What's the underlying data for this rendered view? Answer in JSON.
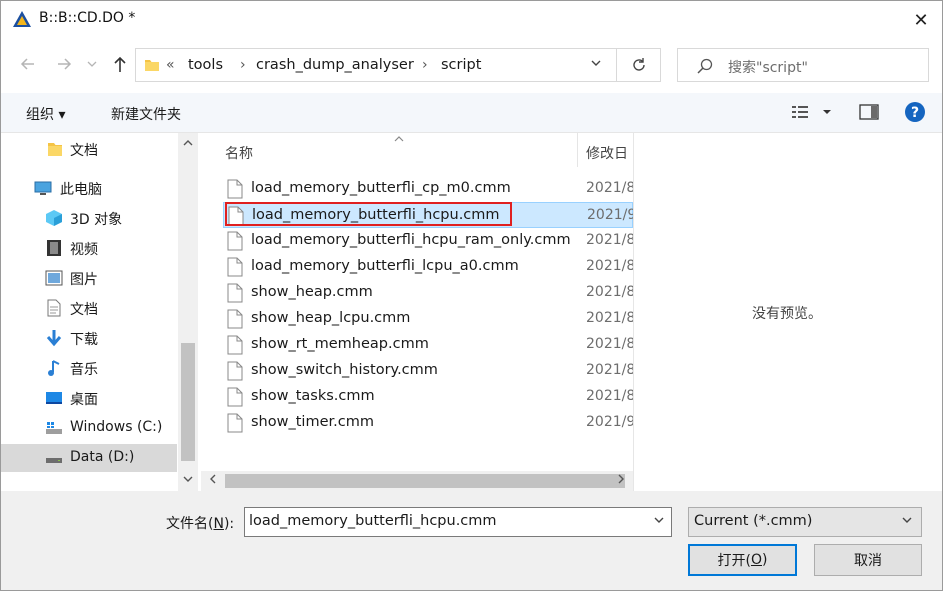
{
  "window": {
    "title": "B::B::CD.DO *"
  },
  "titlebar": {
    "close_glyph": "✕"
  },
  "address": {
    "overflow": "«",
    "crumbs": [
      "tools",
      "crash_dump_analyser",
      "script"
    ],
    "separator": "›"
  },
  "search": {
    "placeholder": "搜索\"script\""
  },
  "toolbar": {
    "organize_label": "组织 ▾",
    "new_folder_label": "新建文件夹"
  },
  "nav": {
    "items": [
      {
        "label": "文档",
        "icon": "folder-icon"
      },
      {
        "label": "此电脑",
        "icon": "computer-icon"
      },
      {
        "label": "3D 对象",
        "icon": "cube-3d-icon"
      },
      {
        "label": "视频",
        "icon": "video-icon"
      },
      {
        "label": "图片",
        "icon": "picture-icon"
      },
      {
        "label": "文档",
        "icon": "document-icon"
      },
      {
        "label": "下载",
        "icon": "download-icon"
      },
      {
        "label": "音乐",
        "icon": "music-icon"
      },
      {
        "label": "桌面",
        "icon": "desktop-icon"
      },
      {
        "label": "Windows (C:)",
        "icon": "drive-c-icon"
      },
      {
        "label": "Data (D:)",
        "icon": "drive-d-icon"
      }
    ]
  },
  "files": {
    "col_name": "名称",
    "col_date": "修改日",
    "rows": [
      {
        "name": "load_memory_butterfli_cp_m0.cmm",
        "date": "2021/8"
      },
      {
        "name": "load_memory_butterfli_hcpu.cmm",
        "date": "2021/9",
        "selected": true
      },
      {
        "name": "load_memory_butterfli_hcpu_ram_only.cmm",
        "date": "2021/8"
      },
      {
        "name": "load_memory_butterfli_lcpu_a0.cmm",
        "date": "2021/8"
      },
      {
        "name": "show_heap.cmm",
        "date": "2021/8"
      },
      {
        "name": "show_heap_lcpu.cmm",
        "date": "2021/8"
      },
      {
        "name": "show_rt_memheap.cmm",
        "date": "2021/8"
      },
      {
        "name": "show_switch_history.cmm",
        "date": "2021/8"
      },
      {
        "name": "show_tasks.cmm",
        "date": "2021/8"
      },
      {
        "name": "show_timer.cmm",
        "date": "2021/9"
      }
    ]
  },
  "preview": {
    "text": "没有预览。"
  },
  "bottom": {
    "filename_label_pre": "文件名(",
    "filename_label_key": "N",
    "filename_label_post": "):",
    "filename_value": "load_memory_butterfli_hcpu.cmm",
    "filter_value": "Current (*.cmm)",
    "open_pre": "打开(",
    "open_key": "O",
    "open_post": ")",
    "cancel_label": "取消"
  },
  "colors": {
    "selection": "#cce8ff",
    "highlight": "#e02020",
    "accent": "#0078d7"
  }
}
